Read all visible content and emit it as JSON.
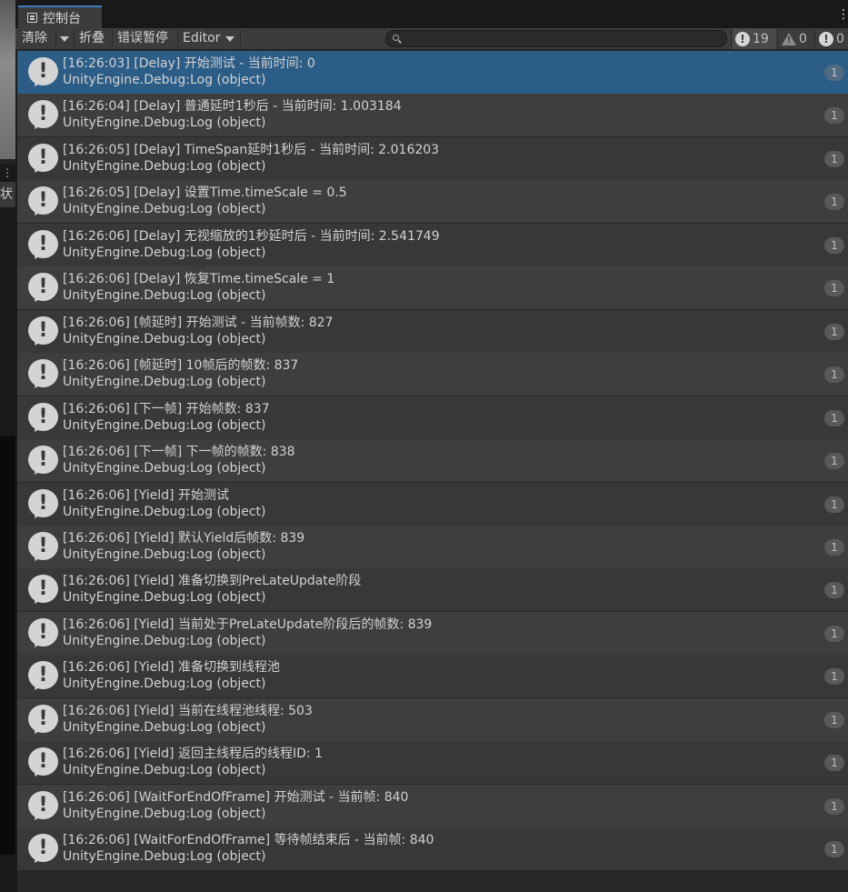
{
  "left_panel": {
    "visible_char": "状"
  },
  "tab": {
    "title": "控制台"
  },
  "toolbar": {
    "clear_label": "清除",
    "collapse_label": "折叠",
    "error_pause_label": "错误暂停",
    "editor_label": "Editor",
    "search": {
      "value": "",
      "placeholder": ""
    },
    "counts": {
      "info": "19",
      "warning": "0",
      "error": "0"
    }
  },
  "logs": [
    {
      "line1": "[16:26:03] [Delay] 开始测试 - 当前时间: 0",
      "line2": "UnityEngine.Debug:Log (object)",
      "count": "1",
      "selected": true
    },
    {
      "line1": "[16:26:04] [Delay] 普通延时1秒后 - 当前时间: 1.003184",
      "line2": "UnityEngine.Debug:Log (object)",
      "count": "1"
    },
    {
      "line1": "[16:26:05] [Delay] TimeSpan延时1秒后 - 当前时间: 2.016203",
      "line2": "UnityEngine.Debug:Log (object)",
      "count": "1"
    },
    {
      "line1": "[16:26:05] [Delay] 设置Time.timeScale = 0.5",
      "line2": "UnityEngine.Debug:Log (object)",
      "count": "1"
    },
    {
      "line1": "[16:26:06] [Delay] 无视缩放的1秒延时后 - 当前时间: 2.541749",
      "line2": "UnityEngine.Debug:Log (object)",
      "count": "1"
    },
    {
      "line1": "[16:26:06] [Delay] 恢复Time.timeScale = 1",
      "line2": "UnityEngine.Debug:Log (object)",
      "count": "1"
    },
    {
      "line1": "[16:26:06] [帧延时] 开始测试 - 当前帧数: 827",
      "line2": "UnityEngine.Debug:Log (object)",
      "count": "1"
    },
    {
      "line1": "[16:26:06] [帧延时] 10帧后的帧数: 837",
      "line2": "UnityEngine.Debug:Log (object)",
      "count": "1"
    },
    {
      "line1": "[16:26:06] [下一帧] 开始帧数: 837",
      "line2": "UnityEngine.Debug:Log (object)",
      "count": "1"
    },
    {
      "line1": "[16:26:06] [下一帧] 下一帧的帧数: 838",
      "line2": "UnityEngine.Debug:Log (object)",
      "count": "1"
    },
    {
      "line1": "[16:26:06] [Yield] 开始测试",
      "line2": "UnityEngine.Debug:Log (object)",
      "count": "1"
    },
    {
      "line1": "[16:26:06] [Yield] 默认Yield后帧数: 839",
      "line2": "UnityEngine.Debug:Log (object)",
      "count": "1"
    },
    {
      "line1": "[16:26:06] [Yield] 准备切换到PreLateUpdate阶段",
      "line2": "UnityEngine.Debug:Log (object)",
      "count": "1"
    },
    {
      "line1": "[16:26:06] [Yield] 当前处于PreLateUpdate阶段后的帧数: 839",
      "line2": "UnityEngine.Debug:Log (object)",
      "count": "1"
    },
    {
      "line1": "[16:26:06] [Yield] 准备切换到线程池",
      "line2": "UnityEngine.Debug:Log (object)",
      "count": "1"
    },
    {
      "line1": "[16:26:06] [Yield] 当前在线程池线程: 503",
      "line2": "UnityEngine.Debug:Log (object)",
      "count": "1"
    },
    {
      "line1": "[16:26:06] [Yield] 返回主线程后的线程ID: 1",
      "line2": "UnityEngine.Debug:Log (object)",
      "count": "1"
    },
    {
      "line1": "[16:26:06] [WaitForEndOfFrame] 开始测试 - 当前帧: 840",
      "line2": "UnityEngine.Debug:Log (object)",
      "count": "1"
    },
    {
      "line1": "[16:26:06] [WaitForEndOfFrame] 等待帧结束后 - 当前帧: 840",
      "line2": "UnityEngine.Debug:Log (object)",
      "count": "1"
    }
  ],
  "colors": {
    "selected_row": "#2c5d87",
    "row_odd": "#383838",
    "row_even": "#3e3e3e",
    "tab_accent": "#3a79bb"
  }
}
